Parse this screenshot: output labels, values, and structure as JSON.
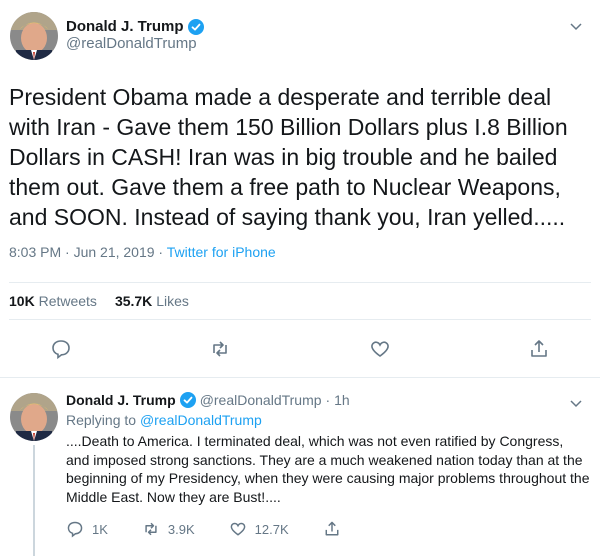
{
  "main_tweet": {
    "display_name": "Donald J. Trump",
    "handle": "@realDonaldTrump",
    "text": "President Obama made a desperate and terrible deal with Iran - Gave them 150 Billion Dollars plus I.8 Billion Dollars in CASH! Iran was in big trouble and he bailed them out. Gave them a free path to Nuclear Weapons, and SOON. Instead of saying thank you, Iran yelled.....",
    "time": "8:03 PM · Jun 21, 2019 · ",
    "source": "Twitter for iPhone",
    "retweets_count": "10K",
    "retweets_label": "Retweets",
    "likes_count": "35.7K",
    "likes_label": "Likes"
  },
  "reply_tweet": {
    "display_name": "Donald J. Trump",
    "handle": "@realDonaldTrump",
    "age": "· 1h",
    "replying_to_label": "Replying to ",
    "replying_to_handle": "@realDonaldTrump",
    "text": "....Death to America. I terminated deal, which was not even ratified by Congress, and imposed strong sanctions. They are a much weakened nation today than at the beginning of my Presidency, when they were causing major problems throughout the Middle East. Now they are Bust!....",
    "reply_count": "1K",
    "retweet_count": "3.9K",
    "like_count": "12.7K"
  },
  "icons": {
    "verified": "verified-badge-icon",
    "chevron": "chevron-down-icon",
    "reply": "comment-bubble-icon",
    "retweet": "retweet-icon",
    "like": "heart-icon",
    "share": "share-icon"
  },
  "colors": {
    "brand_blue": "#1da1f2",
    "text_primary": "#14171a",
    "text_secondary": "#657786",
    "divider": "#e6ecf0"
  }
}
